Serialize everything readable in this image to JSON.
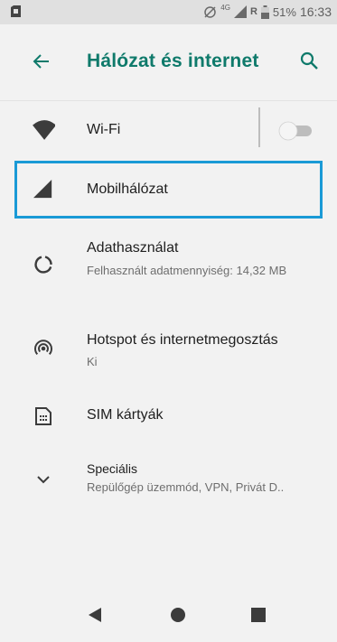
{
  "status_bar": {
    "network_type": "4G",
    "roaming": "R",
    "battery": "51%",
    "time": "16:33"
  },
  "app_bar": {
    "title": "Hálózat és internet",
    "back_icon": "arrow-left-icon",
    "search_icon": "search-icon"
  },
  "items": [
    {
      "title": "Wi-Fi",
      "subtitle": "",
      "icon": "wifi-icon",
      "toggle": false
    },
    {
      "title": "Mobilhálózat",
      "subtitle": "",
      "icon": "cellular-signal-icon"
    },
    {
      "title": "Adathasználat",
      "subtitle": "Felhasznált adatmennyiség: 14,32 MB",
      "icon": "data-usage-icon"
    },
    {
      "title": "Hotspot és internetmegosztás",
      "subtitle": "Ki",
      "icon": "hotspot-icon"
    },
    {
      "title": "SIM kártyák",
      "subtitle": "",
      "icon": "sim-card-icon"
    },
    {
      "title": "Speciális",
      "subtitle": "Repülőgép üzemmód, VPN, Privát D..",
      "icon": "chevron-down-icon"
    }
  ],
  "colors": {
    "accent": "#0f7a6b",
    "highlight_border": "#1a9ad6",
    "background": "#f2f2f2"
  }
}
